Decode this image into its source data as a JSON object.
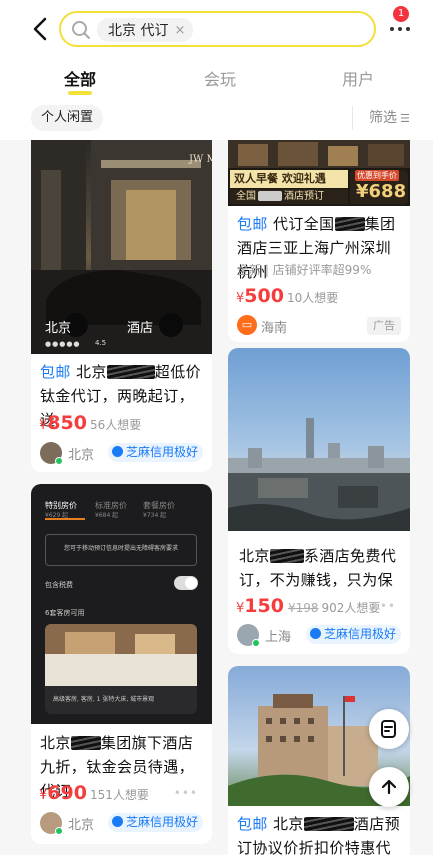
{
  "search": {
    "query": "北京 代订",
    "clear": "×"
  },
  "notifications": {
    "count": "1"
  },
  "tabs": [
    {
      "label": "全部"
    },
    {
      "label": "会玩"
    },
    {
      "label": "用户"
    }
  ],
  "filters": {
    "chip": "个人闲置",
    "sort": "筛选"
  },
  "cards": [
    {
      "photo_caption_left": "北京",
      "photo_caption_right": "酒店",
      "photo_rating": "4.5",
      "photo_sign": "JW M",
      "baoyou": "包邮",
      "title_a": "北京",
      "title_b": "超低价钛金代订，两晚起订，送",
      "price": "850",
      "want": "56人想要",
      "location": "北京",
      "credit": "芝麻信用极好"
    },
    {
      "ad_strip_1": "双人早餐",
      "ad_strip_2": "欢迎礼遇",
      "ad_strip_3": "全国",
      "ad_strip_4": "酒店预订",
      "ad_price_label": "优惠到手价",
      "ad_price": "¥688",
      "baoyou": "包邮",
      "title_a": "代订全国",
      "title_b": "集团酒店三亚上海广州深圳杭州",
      "sub": "全新 | 店铺好评率超99%",
      "price": "500",
      "want": "10人想要",
      "location": "海南",
      "ad": "广告"
    },
    {
      "title_a": "北京",
      "title_b": "系酒店免费代订，不为赚钱，只为保",
      "price": "150",
      "orig": "¥198",
      "want": "902人想要",
      "location": "上海",
      "credit": "芝麻信用极好"
    },
    {
      "ui_tabs": [
        "特别房价",
        "标准房价",
        "套餐房价"
      ],
      "ui_prices": [
        "¥629 起",
        "¥684 起",
        "¥734 起"
      ],
      "ui_notice": "您可于移动预订信息时提出无障碍客房要求",
      "ui_toggle": "包含税费",
      "ui_count": "6套客房可用",
      "ui_footer": "高级客房, 客房, 1 张特大床, 城市景观",
      "title_a": "北京",
      "title_b": "集团旗下酒店九折，钛金会员待遇，代订",
      "price": "690",
      "want": "151人想要",
      "location": "北京",
      "credit": "芝麻信用极好"
    },
    {
      "baoyou": "包邮",
      "title_a": "北京",
      "title_b": "酒店预订协议价折扣价特惠代订"
    }
  ],
  "colors": {
    "accent": "#f5df3a",
    "price": "#f53d3d",
    "link": "#1a7bf5"
  }
}
